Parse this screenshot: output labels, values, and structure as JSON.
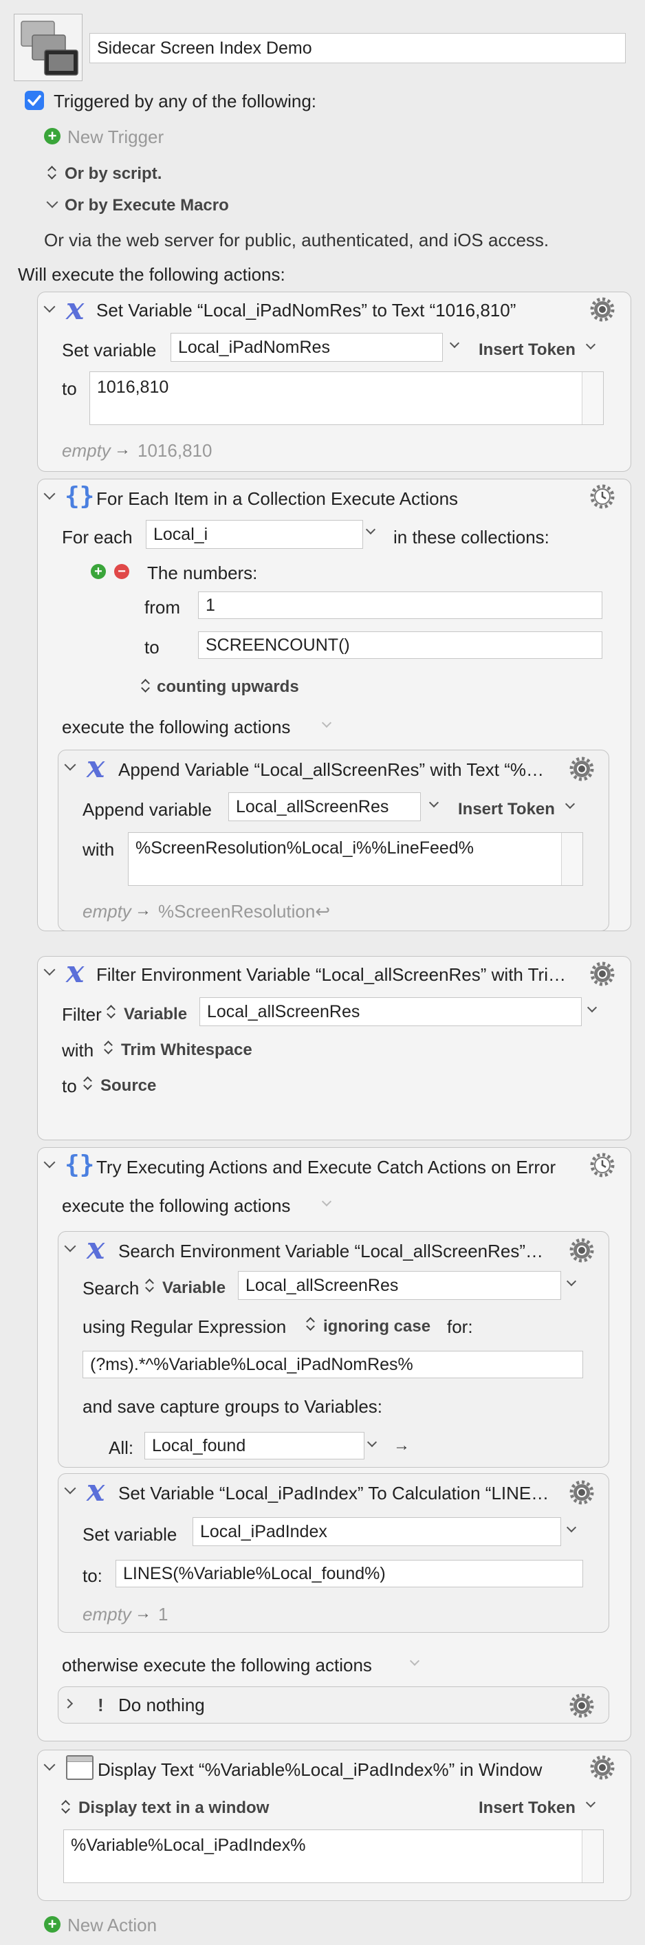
{
  "macro": {
    "name": "Sidecar Screen Index Demo",
    "trigger_label": "Triggered by any of the following:",
    "new_trigger": "New Trigger",
    "or_by_script": "Or by script.",
    "or_by_execute_macro": "Or by Execute Macro",
    "web_note": "Or via the web server for public, authenticated, and iOS access.",
    "will_execute": "Will execute the following actions:",
    "new_action": "New Action"
  },
  "common": {
    "insert_token": "Insert Token",
    "empty": "empty",
    "arrow": "→",
    "execute_following": "execute the following actions"
  },
  "a1": {
    "title": "Set Variable “Local_iPadNomRes” to Text “1016,810”",
    "set_variable_label": "Set variable",
    "variable": "Local_iPadNomRes",
    "to_label": "to",
    "value": "1016,810",
    "preview": "1016,810"
  },
  "a2": {
    "title": "For Each Item in a Collection Execute Actions",
    "for_each_label": "For each",
    "variable": "Local_i",
    "in_collections": "in these collections:",
    "numbers_label": "The numbers:",
    "from_label": "from",
    "from_value": "1",
    "to_label": "to",
    "to_value": "SCREENCOUNT()",
    "direction": "counting upwards",
    "sub": {
      "title": "Append Variable “Local_allScreenRes” with Text “%…",
      "append_label": "Append variable",
      "variable": "Local_allScreenRes",
      "with_label": "with",
      "value": "%ScreenResolution%Local_i%%LineFeed%",
      "preview": "%ScreenResolution↩"
    }
  },
  "a3": {
    "title": "Filter Environment Variable “Local_allScreenRes” with Tri…",
    "filter_label": "Filter",
    "source_type": "Variable",
    "variable": "Local_allScreenRes",
    "with_label": "with",
    "operation": "Trim Whitespace",
    "to_label": "to",
    "destination": "Source"
  },
  "a4": {
    "title": "Try Executing Actions and Execute Catch Actions on Error",
    "otherwise": "otherwise execute the following actions",
    "search": {
      "title": "Search Environment Variable “Local_allScreenRes”…",
      "search_label": "Search",
      "source_type": "Variable",
      "variable": "Local_allScreenRes",
      "using_label": "using Regular Expression",
      "case": "ignoring case",
      "for_label": "for:",
      "regex": "(?ms).*^%Variable%Local_iPadNomRes%",
      "save_label": "and save capture groups to Variables:",
      "all_label": "All:",
      "all_var": "Local_found"
    },
    "setvar": {
      "title": "Set Variable “Local_iPadIndex” To Calculation “LINE…",
      "set_variable_label": "Set variable",
      "variable": "Local_iPadIndex",
      "to_label": "to:",
      "value": "LINES(%Variable%Local_found%)",
      "preview": "1"
    },
    "nothing": {
      "title": "Do nothing"
    }
  },
  "a5": {
    "title": "Display Text “%Variable%Local_iPadIndex%” in Window",
    "mode": "Display text in a window",
    "value": "%Variable%Local_iPadIndex%"
  },
  "colors": {
    "accent": "#2f7cf6",
    "variable_icon": "#5b6fd9",
    "add": "#3aa53a",
    "remove": "#e04848"
  }
}
